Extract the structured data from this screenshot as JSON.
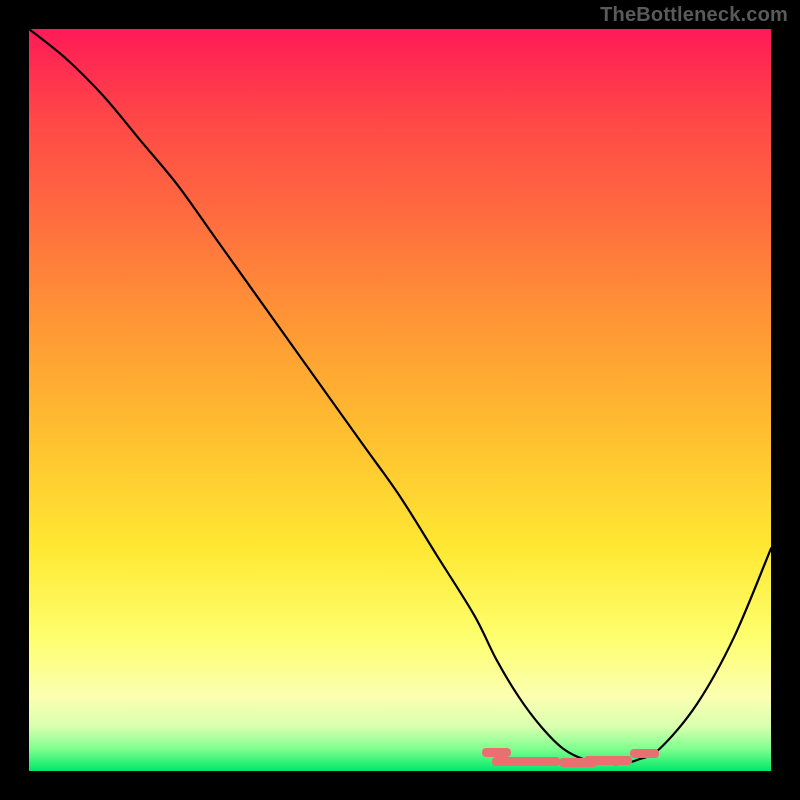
{
  "watermark": "TheBottleneck.com",
  "chart_data": {
    "type": "line",
    "title": "",
    "xlabel": "",
    "ylabel": "",
    "xlim": [
      0,
      100
    ],
    "ylim": [
      0,
      100
    ],
    "series": [
      {
        "name": "curve",
        "x": [
          0,
          5,
          10,
          15,
          20,
          25,
          30,
          35,
          40,
          45,
          50,
          55,
          60,
          63,
          66,
          69,
          72,
          75,
          78,
          80,
          82,
          85,
          90,
          95,
          100
        ],
        "values": [
          100,
          96,
          91,
          85,
          79,
          72,
          65,
          58,
          51,
          44,
          37,
          29,
          21,
          15,
          10,
          6,
          3,
          1.5,
          1,
          1,
          1.5,
          3,
          9,
          18,
          30
        ]
      }
    ],
    "markers": {
      "comment": "approximate positions of the coral dashes near the trough",
      "dashes": [
        {
          "x": 63,
          "y": 2.5,
          "len": 3
        },
        {
          "x": 67,
          "y": 1.4,
          "len": 7
        },
        {
          "x": 74,
          "y": 1.2,
          "len": 4
        },
        {
          "x": 78,
          "y": 1.5,
          "len": 5
        },
        {
          "x": 83,
          "y": 2.4,
          "len": 3
        }
      ]
    },
    "background_gradient": {
      "top": "#ff1a58",
      "bottom": "#00e86a"
    }
  }
}
